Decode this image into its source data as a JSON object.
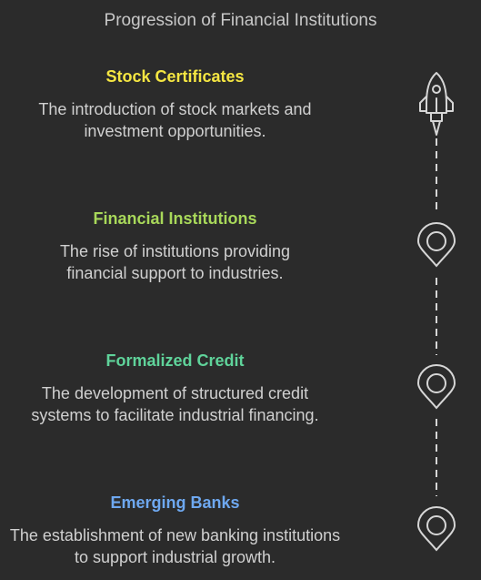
{
  "title": "Progression of Financial Institutions",
  "colors": {
    "background": "#2b2b2b",
    "icon_stroke": "#d6d6d6",
    "stock_certificates": "#f5e642",
    "financial_institutions": "#a8d85a",
    "formalized_credit": "#5fd39a",
    "emerging_banks": "#6ea8f0"
  },
  "steps": [
    {
      "heading": "Stock Certificates",
      "description": "The introduction of stock markets and investment opportunities.",
      "icon": "rocket-icon"
    },
    {
      "heading": "Financial Institutions",
      "description": "The rise of institutions providing financial support to industries.",
      "icon": "location-pin-icon"
    },
    {
      "heading": "Formalized Credit",
      "description": "The development of structured credit systems to facilitate industrial financing.",
      "icon": "location-pin-icon"
    },
    {
      "heading": "Emerging Banks",
      "description": "The establishment of new banking institutions to support industrial growth.",
      "icon": "location-pin-icon"
    }
  ]
}
